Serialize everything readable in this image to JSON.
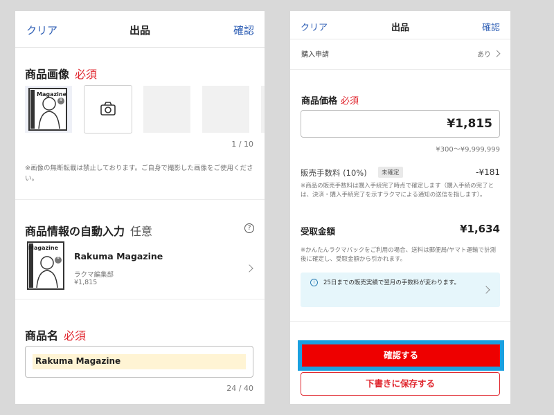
{
  "left": {
    "header": {
      "clear": "クリア",
      "title": "出品",
      "confirm": "確認"
    },
    "images": {
      "heading": "商品画像",
      "required": "必須",
      "thumb_text": "Magazine",
      "thumb_badge": "8",
      "counter": "1 / 10",
      "note": "※画像の無断転載は禁止しております。ご自身で撮影した画像をご使用ください。"
    },
    "auto": {
      "heading": "商品情報の自動入力",
      "optional": "任意",
      "help": "?",
      "thumb_text": "Magazine",
      "thumb_badge": "8",
      "title": "Rakuma Magazine",
      "publisher": "ラクマ編集部",
      "price": "¥1,815"
    },
    "name": {
      "heading": "商品名",
      "required": "必須",
      "value": "Rakuma Magazine",
      "counter": "24 / 40"
    }
  },
  "right": {
    "header": {
      "clear": "クリア",
      "title": "出品",
      "confirm": "確認"
    },
    "purchase": {
      "label": "購入申請",
      "value": "あり"
    },
    "price": {
      "heading": "商品価格",
      "required": "必須",
      "value": "¥1,815",
      "range": "¥300〜¥9,999,999"
    },
    "fee": {
      "label": "販売手数料 (10%)",
      "badge": "未確定",
      "value": "-¥181",
      "note": "※商品の販売手数料は購入手続完了時点で確定します（購入手続の完了とは、決済・購入手続完了を示すラクマによる通知の送信を指します）。"
    },
    "receive": {
      "label": "受取金額",
      "value": "¥1,634",
      "note": "※かんたんラクマパックをご利用の場合、送料は郵便局/ヤマト運輸で計測後に確定し、受取金額から引かれます。"
    },
    "info": {
      "icon": "i",
      "text": "25日までの販売実績で翌月の手数料が変わります。"
    },
    "buttons": {
      "confirm": "確認する",
      "draft": "下書きに保存する"
    }
  },
  "colors": {
    "accent_blue": "#2f5fb5",
    "required_red": "#e0262e",
    "button_red": "#ee0000",
    "focus_blue": "#1aa0e0",
    "info_bg": "#e6f6fb"
  }
}
